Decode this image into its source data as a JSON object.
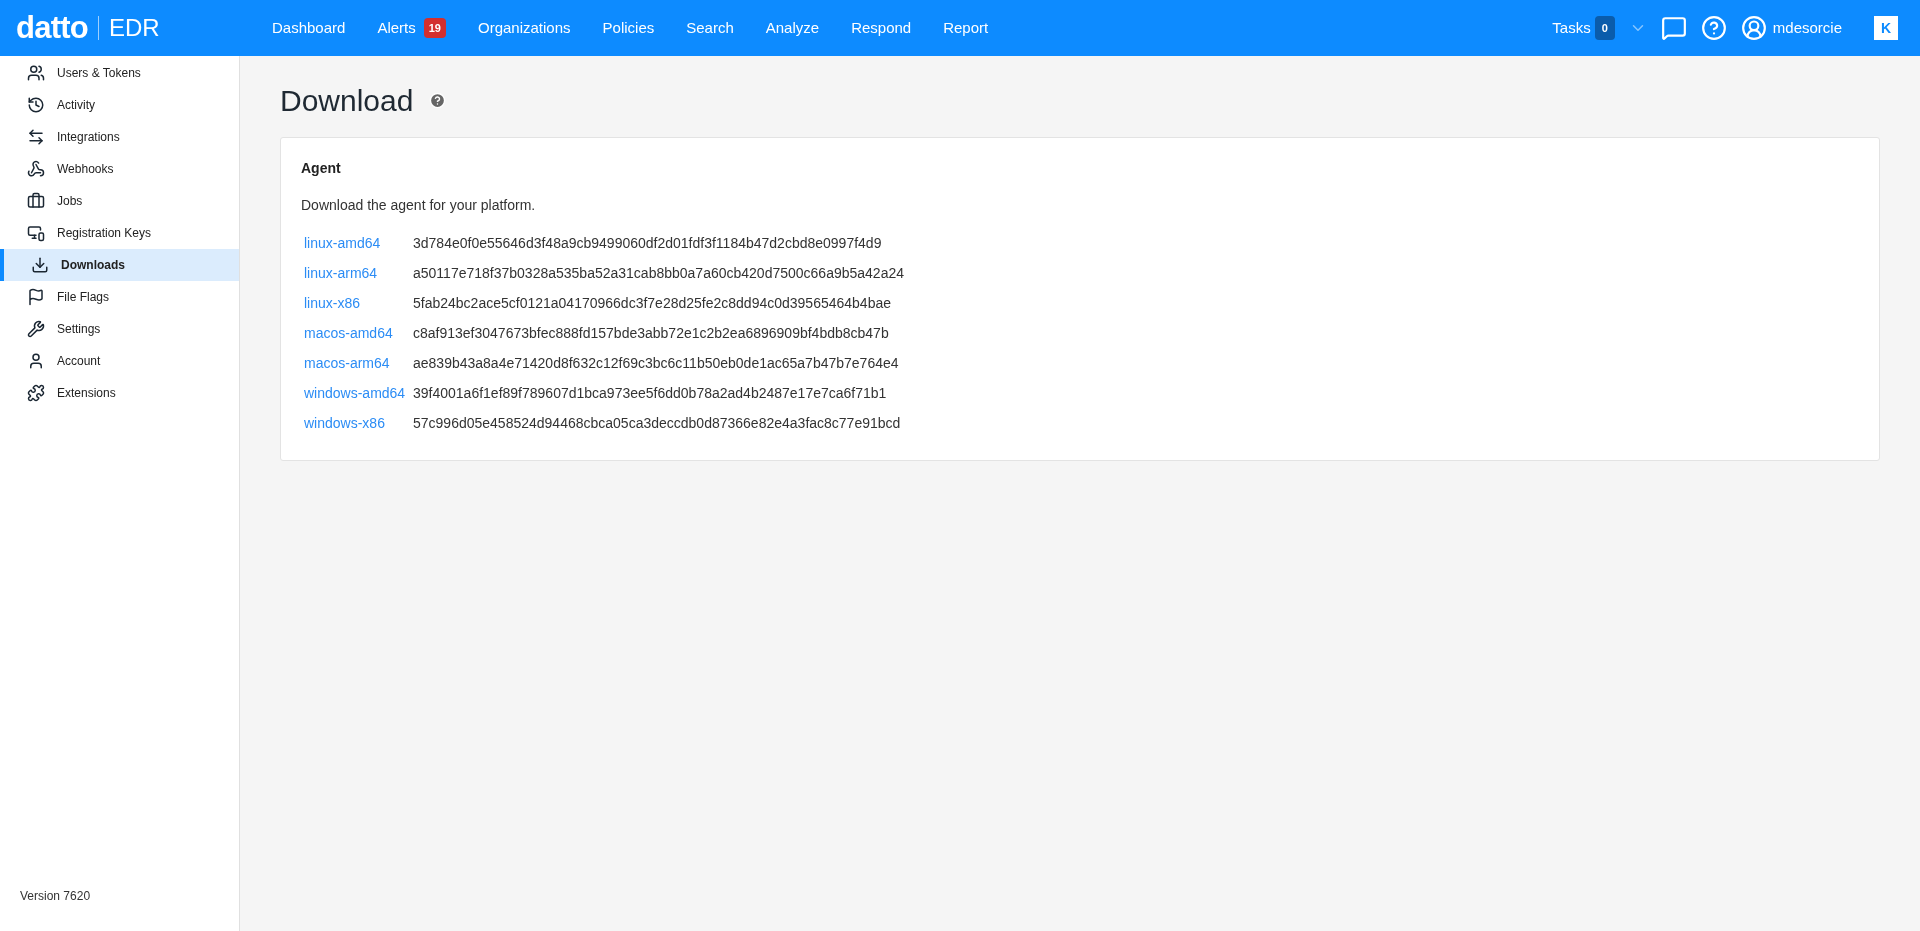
{
  "header": {
    "logo": "datto",
    "product": "EDR",
    "nav": [
      {
        "label": "Dashboard"
      },
      {
        "label": "Alerts",
        "badge": "19"
      },
      {
        "label": "Organizations"
      },
      {
        "label": "Policies"
      },
      {
        "label": "Search"
      },
      {
        "label": "Analyze"
      },
      {
        "label": "Respond"
      },
      {
        "label": "Report"
      }
    ],
    "tasks": {
      "label": "Tasks",
      "count": "0"
    },
    "user": "mdesorcie",
    "app_badge": "K"
  },
  "sidebar": {
    "items": [
      {
        "label": "Users & Tokens",
        "selected": false
      },
      {
        "label": "Activity",
        "selected": false
      },
      {
        "label": "Integrations",
        "selected": false
      },
      {
        "label": "Webhooks",
        "selected": false
      },
      {
        "label": "Jobs",
        "selected": false
      },
      {
        "label": "Registration Keys",
        "selected": false
      },
      {
        "label": "Downloads",
        "selected": true
      },
      {
        "label": "File Flags",
        "selected": false
      },
      {
        "label": "Settings",
        "selected": false
      },
      {
        "label": "Account",
        "selected": false
      },
      {
        "label": "Extensions",
        "selected": false
      }
    ],
    "version": "Version 7620"
  },
  "page": {
    "title": "Download",
    "card": {
      "title": "Agent",
      "description": "Download the agent for your platform.",
      "downloads": [
        {
          "platform": "linux-amd64",
          "hash": "3d784e0f0e55646d3f48a9cb9499060df2d01fdf3f1184b47d2cbd8e0997f4d9"
        },
        {
          "platform": "linux-arm64",
          "hash": "a50117e718f37b0328a535ba52a31cab8bb0a7a60cb420d7500c66a9b5a42a24"
        },
        {
          "platform": "linux-x86",
          "hash": "5fab24bc2ace5cf0121a04170966dc3f7e28d25fe2c8dd94c0d39565464b4bae"
        },
        {
          "platform": "macos-amd64",
          "hash": "c8af913ef3047673bfec888fd157bde3abb72e1c2b2ea6896909bf4bdb8cb47b"
        },
        {
          "platform": "macos-arm64",
          "hash": "ae839b43a8a4e71420d8f632c12f69c3bc6c11b50eb0de1ac65a7b47b7e764e4"
        },
        {
          "platform": "windows-amd64",
          "hash": "39f4001a6f1ef89f789607d1bca973ee5f6dd0b78a2ad4b2487e17e7ca6f71b1"
        },
        {
          "platform": "windows-x86",
          "hash": "57c996d05e458524d94468cbca05ca3deccdb0d87366e82e4a3fac8c77e91bcd"
        }
      ]
    }
  }
}
